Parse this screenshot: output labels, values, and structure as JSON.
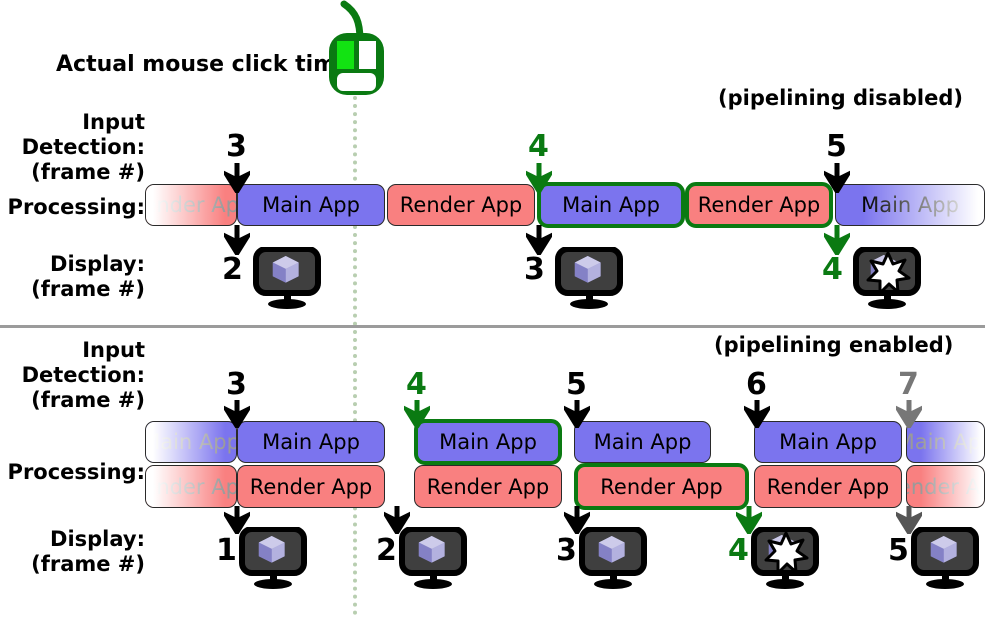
{
  "title_labels": {
    "click_time": "Actual mouse click time:",
    "input_detection": "Input\nDetection:\n(frame #)",
    "processing": "Processing:",
    "display": "Display:\n(frame #)"
  },
  "modes": {
    "top": "(pipelining disabled)",
    "bottom": "(pipelining enabled)"
  },
  "colors": {
    "main_app": "#7b74ee",
    "render_app": "#f98080",
    "highlight": "#0a7a12",
    "mouse": "#0a7a12",
    "mouse_button_active": "#12e312",
    "divider": "#9b9b9b",
    "dotted_line": "#b8ceb0",
    "faded_text": "#9a9a9a"
  },
  "icons": {
    "mouse": "mouse-icon",
    "monitor_cube": "monitor-cube-icon",
    "monitor_star": "monitor-star-icon",
    "arrow_down": "arrow-down-icon"
  },
  "bar_labels": {
    "main": "Main App",
    "render": "Render App"
  },
  "sections": [
    {
      "id": "pipelining-disabled",
      "mode_label": "(pipelining disabled)",
      "input_frames": [
        {
          "label": "3",
          "color": "black"
        },
        {
          "label": "4",
          "color": "green"
        },
        {
          "label": "5",
          "color": "black"
        }
      ],
      "processing_bars": [
        {
          "label": "Render App",
          "kind": "render",
          "faded": "left",
          "highlight": false
        },
        {
          "label": "Main App",
          "kind": "main",
          "faded": "none",
          "highlight": false
        },
        {
          "label": "Render App",
          "kind": "render",
          "faded": "none",
          "highlight": false
        },
        {
          "label": "Main App",
          "kind": "main",
          "faded": "none",
          "highlight": true
        },
        {
          "label": "Render App",
          "kind": "render",
          "faded": "none",
          "highlight": true
        },
        {
          "label": "Main App",
          "kind": "main",
          "faded": "right",
          "highlight": false
        }
      ],
      "display_frames": [
        {
          "label": "2",
          "color": "black",
          "icon": "monitor-cube-icon"
        },
        {
          "label": "3",
          "color": "black",
          "icon": "monitor-cube-icon"
        },
        {
          "label": "4",
          "color": "green",
          "icon": "monitor-star-icon"
        }
      ]
    },
    {
      "id": "pipelining-enabled",
      "mode_label": "(pipelining enabled)",
      "input_frames": [
        {
          "label": "3",
          "color": "black"
        },
        {
          "label": "4",
          "color": "green"
        },
        {
          "label": "5",
          "color": "black"
        },
        {
          "label": "6",
          "color": "black"
        },
        {
          "label": "7",
          "color": "gray"
        }
      ],
      "main_bars": [
        {
          "label": "Main App",
          "faded": "left",
          "highlight": false
        },
        {
          "label": "Main App",
          "faded": "none",
          "highlight": false
        },
        {
          "label": "Main App",
          "faded": "none",
          "highlight": true
        },
        {
          "label": "Main App",
          "faded": "none",
          "highlight": false
        },
        {
          "label": "Main App",
          "faded": "none",
          "highlight": false
        },
        {
          "label": "Main App",
          "faded": "right",
          "highlight": false
        }
      ],
      "render_bars": [
        {
          "label": "Render App",
          "faded": "left",
          "highlight": false
        },
        {
          "label": "Render App",
          "faded": "none",
          "highlight": false
        },
        {
          "label": "Render App",
          "faded": "none",
          "highlight": false
        },
        {
          "label": "Render App",
          "faded": "none",
          "highlight": true
        },
        {
          "label": "Render App",
          "faded": "none",
          "highlight": false
        },
        {
          "label": "Render App",
          "faded": "right",
          "highlight": false
        }
      ],
      "display_frames": [
        {
          "label": "1",
          "color": "black",
          "icon": "monitor-cube-icon"
        },
        {
          "label": "2",
          "color": "black",
          "icon": "monitor-cube-icon"
        },
        {
          "label": "3",
          "color": "black",
          "icon": "monitor-cube-icon"
        },
        {
          "label": "4",
          "color": "green",
          "icon": "monitor-star-icon"
        },
        {
          "label": "5",
          "color": "gray",
          "icon": "monitor-cube-icon"
        }
      ]
    }
  ]
}
